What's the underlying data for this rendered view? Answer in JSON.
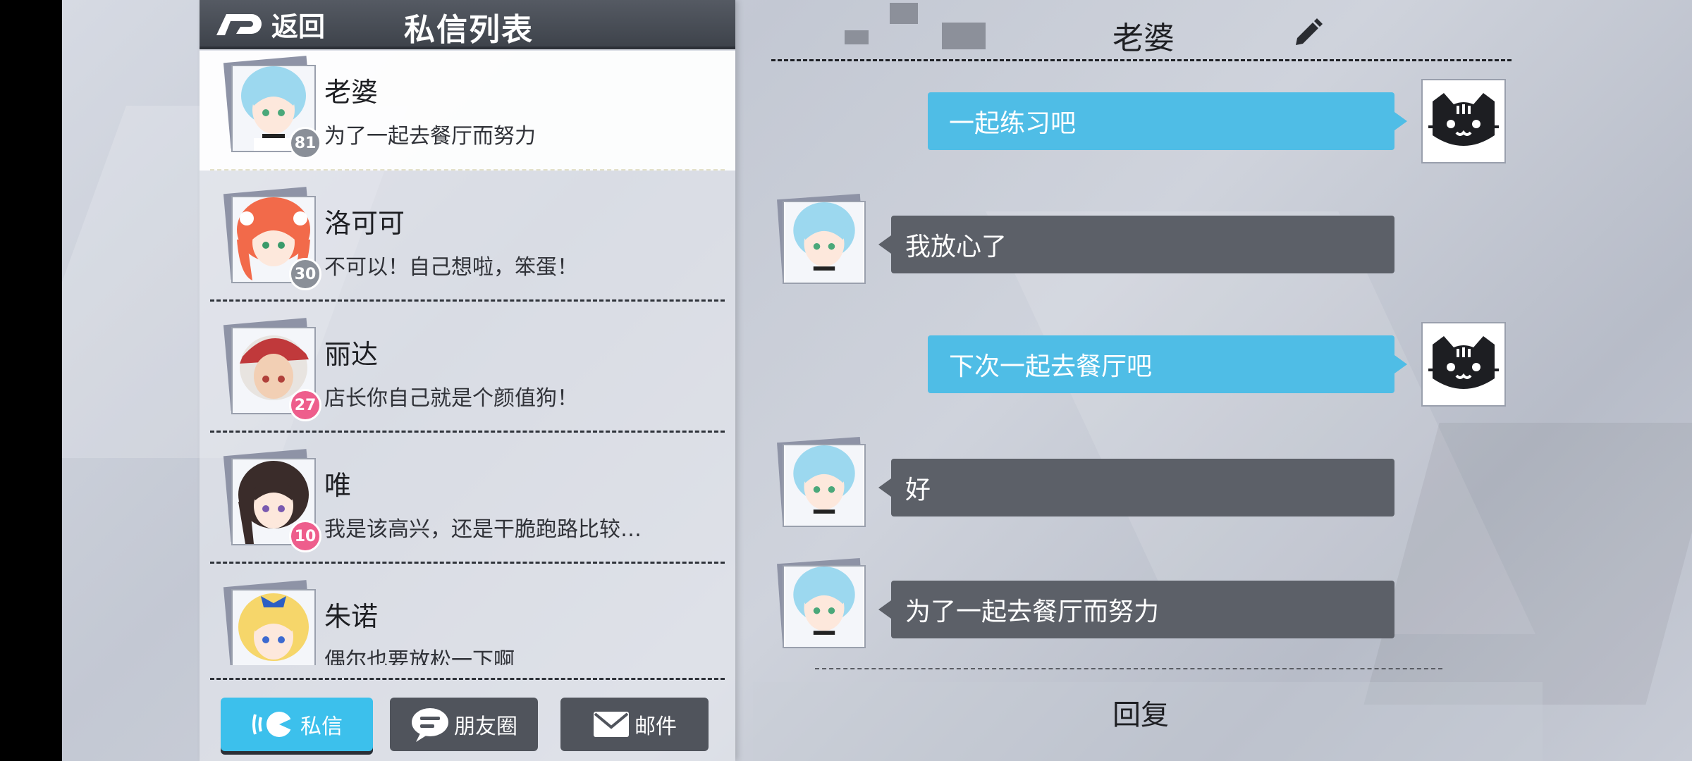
{
  "header": {
    "back_label": "返回",
    "title": "私信列表"
  },
  "conversations": [
    {
      "name": "老婆",
      "preview": "为了一起去餐厅而努力",
      "level": "81",
      "badge_color": "grey",
      "active": true,
      "hair": "#9cd8ef"
    },
    {
      "name": "洛可可",
      "preview": "不可以！自己想啦，笨蛋！",
      "level": "30",
      "badge_color": "grey",
      "active": false,
      "hair": "#f26a4a"
    },
    {
      "name": "丽达",
      "preview": "店长你自己就是个颜值狗！",
      "level": "27",
      "badge_color": "pink",
      "active": false,
      "hair": "#e8e4e0"
    },
    {
      "name": "唯",
      "preview": "我是该高兴，还是干脆跑路比较…",
      "level": "10",
      "badge_color": "pink",
      "active": false,
      "hair": "#3a2c2a"
    },
    {
      "name": "朱诺",
      "preview": "偶尔也要放松一下啊",
      "level": "",
      "badge_color": "grey",
      "active": false,
      "hair": "#f6d66a"
    }
  ],
  "tabs": [
    {
      "label": "私信",
      "icon": "chat-bubble-icon",
      "active": true
    },
    {
      "label": "朋友圈",
      "icon": "moments-icon",
      "active": false
    },
    {
      "label": "邮件",
      "icon": "mail-icon",
      "active": false
    }
  ],
  "chat": {
    "title": "老婆",
    "edit_icon": "pencil-icon",
    "messages": [
      {
        "from": "me",
        "text": "一起练习吧"
      },
      {
        "from": "them",
        "text": "我放心了"
      },
      {
        "from": "me",
        "text": "下次一起去餐厅吧"
      },
      {
        "from": "them",
        "text": "好"
      },
      {
        "from": "them",
        "text": "为了一起去餐厅而努力"
      }
    ],
    "reply_label": "回复"
  },
  "colors": {
    "accent": "#3cc0ec",
    "my_bubble": "#4fbde6",
    "their_bubble": "#5c6068",
    "header": "#484c55",
    "pink_badge": "#ee5e8c"
  }
}
